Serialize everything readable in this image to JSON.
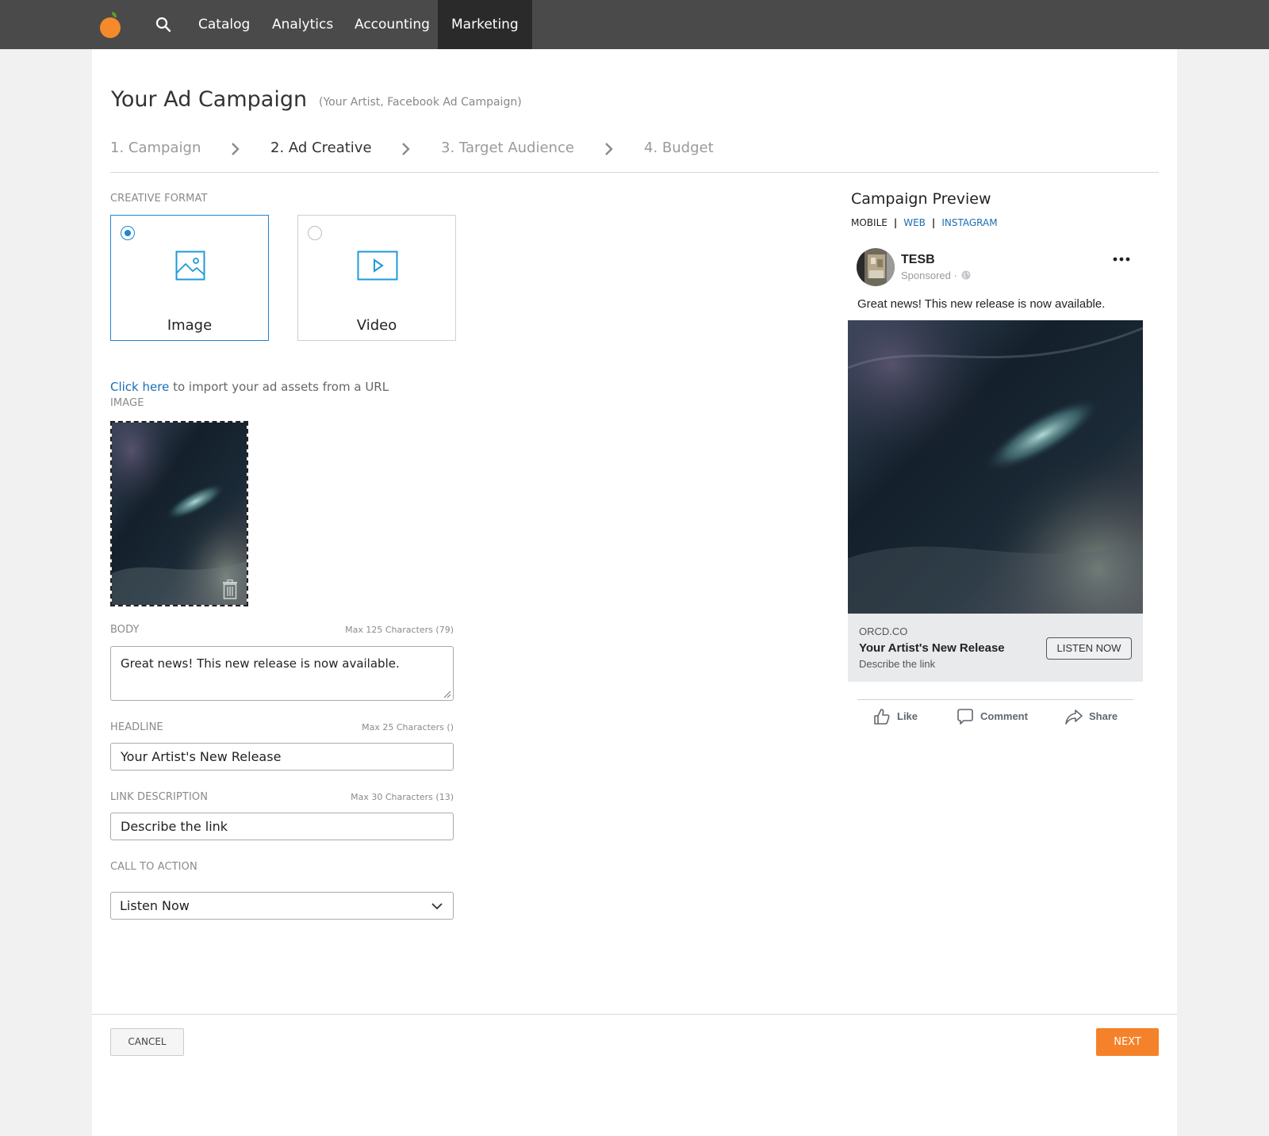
{
  "nav": {
    "items": [
      {
        "label": "Catalog"
      },
      {
        "label": "Analytics"
      },
      {
        "label": "Accounting"
      },
      {
        "label": "Marketing",
        "active": true
      }
    ]
  },
  "header": {
    "title": "Your Ad Campaign",
    "subtitle": "(Your Artist, Facebook Ad Campaign)"
  },
  "steps": [
    {
      "number": "1.",
      "label": "Campaign"
    },
    {
      "number": "2.",
      "label": "Ad Creative",
      "current": true
    },
    {
      "number": "3.",
      "label": "Target Audience"
    },
    {
      "number": "4.",
      "label": "Budget"
    }
  ],
  "form": {
    "format_label": "CREATIVE FORMAT",
    "formats": [
      {
        "label": "Image",
        "selected": true,
        "icon": "image-icon"
      },
      {
        "label": "Video",
        "selected": false,
        "icon": "video-icon"
      }
    ],
    "import_link": "Click here",
    "import_text": " to import your ad assets from a URL",
    "image_label": "IMAGE",
    "body_label": "BODY",
    "body_hint": "Max 125 Characters (79)",
    "body_value": "Great news! This new release is now available.",
    "headline_label": "HEADLINE",
    "headline_hint": "Max 25 Characters ()",
    "headline_value": "Your Artist's New Release",
    "link_desc_label": "LINK DESCRIPTION",
    "link_desc_hint": "Max 30 Characters (13)",
    "link_desc_value": "Describe the link",
    "cta_label": "CALL TO ACTION",
    "cta_value": "Listen Now"
  },
  "preview": {
    "title": "Campaign Preview",
    "tabs": [
      {
        "label": "MOBILE",
        "active": true
      },
      {
        "label": "WEB",
        "active": false
      },
      {
        "label": "INSTAGRAM",
        "active": false
      }
    ],
    "page_name": "TESB",
    "sponsored": "Sponsored ·",
    "post_text": "Great news! This new release is now available.",
    "domain": "ORCD.CO",
    "headline": "Your Artist's New Release",
    "description": "Describe the link",
    "cta": "LISTEN NOW",
    "actions": [
      {
        "label": "Like",
        "icon": "thumbs-up-icon"
      },
      {
        "label": "Comment",
        "icon": "comment-icon"
      },
      {
        "label": "Share",
        "icon": "share-icon"
      }
    ]
  },
  "footer": {
    "cancel": "CANCEL",
    "next": "NEXT"
  },
  "colors": {
    "nav_bg": "#4a4a4a",
    "nav_active": "#2a2a2a",
    "accent_blue": "#1e86d4",
    "link_blue": "#1a6eb5",
    "next_orange": "#f5822a",
    "logo_orange": "#f58a2a",
    "logo_leaf": "#5aa02c"
  }
}
